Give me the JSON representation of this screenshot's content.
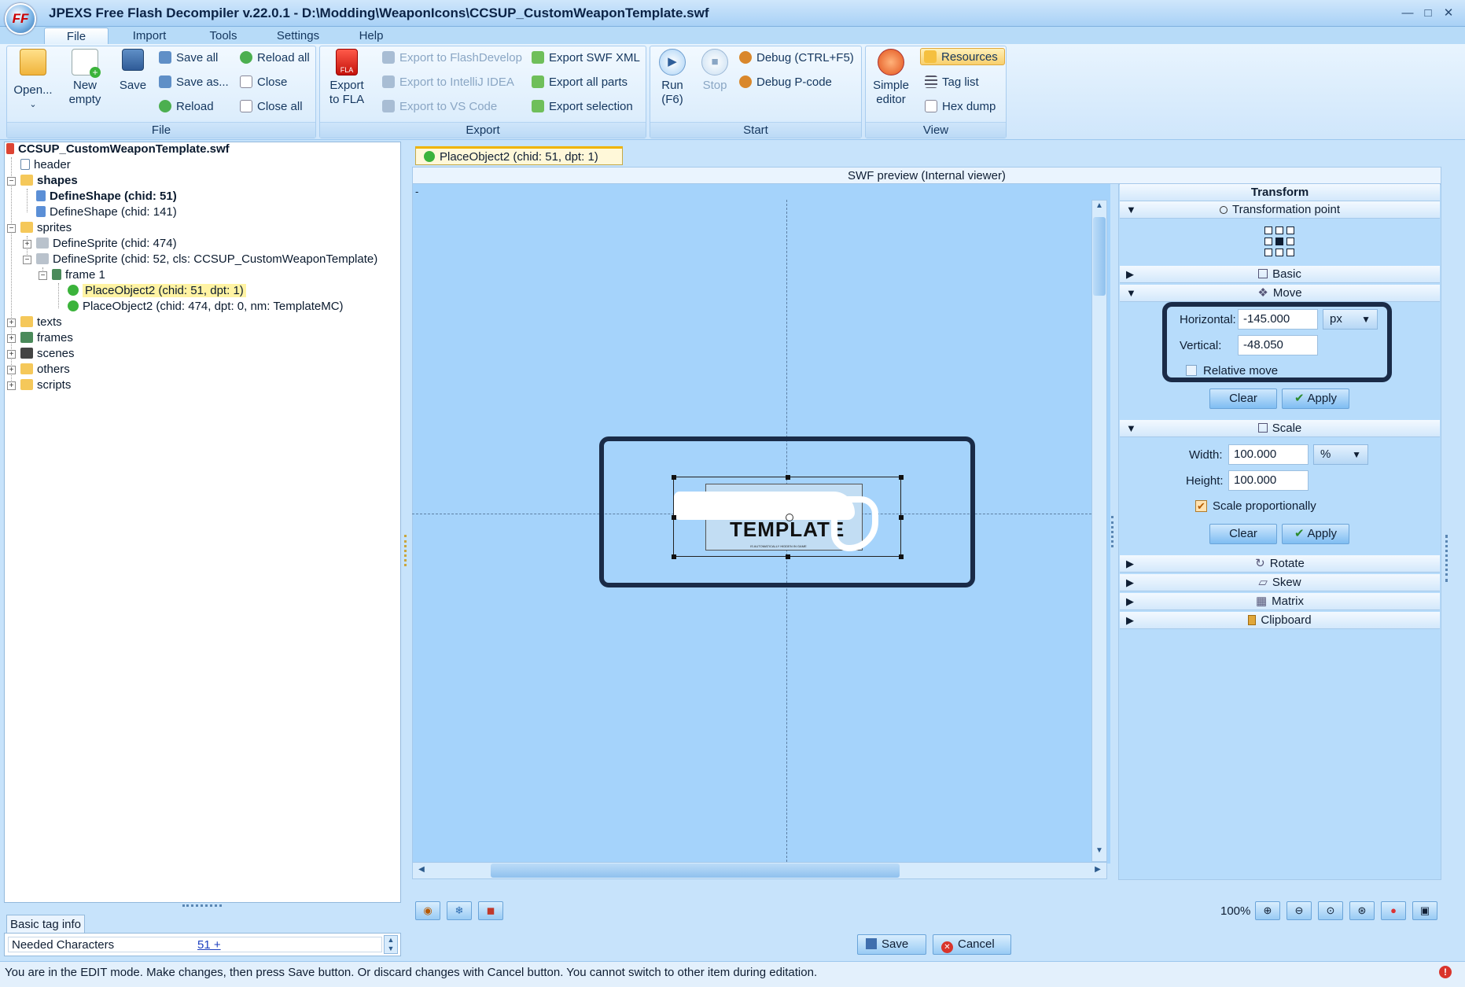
{
  "window": {
    "title": "JPEXS Free Flash Decompiler v.22.0.1 - D:\\Modding\\WeaponIcons\\CCSUP_CustomWeaponTemplate.swf",
    "logo_text": "FF"
  },
  "menu": {
    "tabs": [
      "File",
      "Import",
      "Tools",
      "Settings",
      "Help"
    ],
    "active": "File"
  },
  "ribbon": {
    "file_group": {
      "label": "File",
      "open": "Open...",
      "new_empty_1": "New",
      "new_empty_2": "empty",
      "save": "Save",
      "save_all": "Save all",
      "save_as": "Save as...",
      "reload": "Reload",
      "reload_all": "Reload all",
      "close": "Close",
      "close_all": "Close all"
    },
    "export_group": {
      "label": "Export",
      "export_to_fla_1": "Export",
      "export_to_fla_2": "to FLA",
      "export_flashdevelop": "Export to FlashDevelop",
      "export_intellij": "Export to IntelliJ IDEA",
      "export_vscode": "Export to VS Code",
      "export_swf_xml": "Export SWF XML",
      "export_all_parts": "Export all parts",
      "export_selection": "Export selection"
    },
    "start_group": {
      "label": "Start",
      "run_1": "Run",
      "run_2": "(F6)",
      "stop": "Stop",
      "debug": "Debug (CTRL+F5)",
      "debug_pcode": "Debug P-code"
    },
    "view_group": {
      "label": "View",
      "simple_editor_1": "Simple",
      "simple_editor_2": "editor",
      "resources": "Resources",
      "tag_list": "Tag list",
      "hex_dump": "Hex dump"
    }
  },
  "tree": {
    "root": "CCSUP_CustomWeaponTemplate.swf",
    "header": "header",
    "shapes": "shapes",
    "shape_51": "DefineShape (chid: 51)",
    "shape_141": "DefineShape (chid: 141)",
    "sprites": "sprites",
    "sprite_474": "DefineSprite (chid: 474)",
    "sprite_52": "DefineSprite (chid: 52, cls: CCSUP_CustomWeaponTemplate)",
    "frame_1": "frame 1",
    "place_51": "PlaceObject2 (chid: 51, dpt: 1)",
    "place_474": "PlaceObject2 (chid: 474, dpt: 0, nm: TemplateMC)",
    "texts": "texts",
    "frames": "frames",
    "scenes": "scenes",
    "others": "others",
    "scripts": "scripts"
  },
  "tag_info": {
    "tab": "Basic tag info",
    "row_label": "Needed Characters",
    "row_value": "51 +"
  },
  "editor": {
    "tab_label": "PlaceObject2 (chid: 51, dpt: 1)",
    "preview_header": "SWF preview (Internal viewer)",
    "canvas_text": "TEMPLATE",
    "canvas_note": "IS AUTOMATICALLY HIDDEN IN GAME"
  },
  "transform": {
    "title": "Transform",
    "transformation_point": "Transformation point",
    "basic": "Basic",
    "move": "Move",
    "horizontal_label": "Horizontal:",
    "horizontal_value": "-145.000",
    "vertical_label": "Vertical:",
    "vertical_value": "-48.050",
    "unit_px": "px",
    "relative_move": "Relative move",
    "clear": "Clear",
    "apply": "Apply",
    "scale": "Scale",
    "width_label": "Width:",
    "width_value": "100.000",
    "height_label": "Height:",
    "height_value": "100.000",
    "unit_percent": "%",
    "scale_proportionally": "Scale proportionally",
    "rotate": "Rotate",
    "skew": "Skew",
    "matrix": "Matrix",
    "clipboard": "Clipboard"
  },
  "bottom": {
    "zoom": "100%",
    "save": "Save",
    "cancel": "Cancel"
  },
  "status": {
    "message": "You are in the EDIT mode. Make changes, then press Save button. Or discard changes with Cancel button. You cannot switch to other item during editation."
  },
  "colors": {
    "accent": "#7fbdf2",
    "highlight_frame": "#1a2b47",
    "selection": "#fff3a3"
  }
}
